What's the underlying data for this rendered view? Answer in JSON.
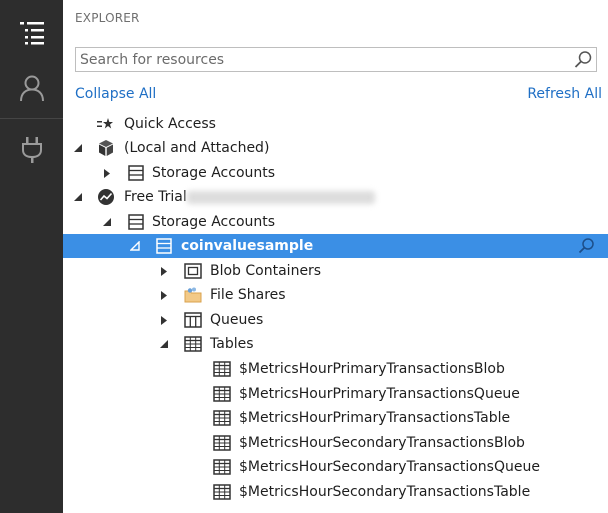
{
  "activity_bar": {
    "items": [
      {
        "icon": "explorer-list-icon",
        "selected": true
      },
      {
        "icon": "account-icon",
        "selected": false
      },
      {
        "icon": "plug-icon",
        "selected": false
      }
    ]
  },
  "explorer": {
    "title": "EXPLORER",
    "search_placeholder": "Search for resources",
    "collapse_all": "Collapse All",
    "refresh_all": "Refresh All"
  },
  "tree": {
    "quick_access": "Quick Access",
    "local_attached": "(Local and Attached)",
    "local_storage_accounts": "Storage Accounts",
    "free_trial": "Free Trial",
    "trial_storage_accounts": "Storage Accounts",
    "account": "coinvaluesample",
    "blob_containers": "Blob Containers",
    "file_shares": "File Shares",
    "queues": "Queues",
    "tables": "Tables",
    "table_items": [
      "$MetricsHourPrimaryTransactionsBlob",
      "$MetricsHourPrimaryTransactionsQueue",
      "$MetricsHourPrimaryTransactionsTable",
      "$MetricsHourSecondaryTransactionsBlob",
      "$MetricsHourSecondaryTransactionsQueue",
      "$MetricsHourSecondaryTransactionsTable"
    ]
  },
  "colors": {
    "activity_bar": "#2d2d2d",
    "selection": "#3b8fe5",
    "link": "#1f6fc5"
  }
}
